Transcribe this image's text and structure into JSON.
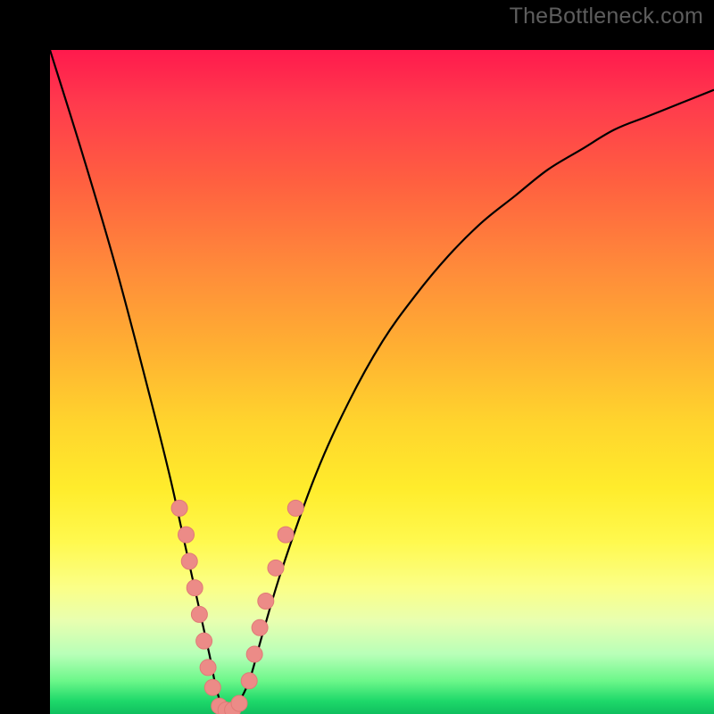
{
  "watermark": "TheBottleneck.com",
  "colors": {
    "frame": "#000000",
    "curve": "#000000",
    "marker_fill": "#ec8b87",
    "marker_stroke": "#e07a76",
    "gradient_top": "#ff1a4d",
    "gradient_bottom": "#0fbf5f"
  },
  "chart_data": {
    "type": "line",
    "title": "",
    "xlabel": "",
    "ylabel": "",
    "xlim": [
      0,
      100
    ],
    "ylim": [
      0,
      100
    ],
    "series": [
      {
        "name": "bottleneck-curve",
        "x": [
          0,
          5,
          10,
          15,
          18,
          20,
          22,
          24,
          25,
          26,
          27,
          28,
          30,
          32,
          35,
          40,
          45,
          50,
          55,
          60,
          65,
          70,
          75,
          80,
          85,
          90,
          95,
          100
        ],
        "y": [
          100,
          84,
          67,
          48,
          36,
          27,
          18,
          9,
          4,
          1,
          0,
          1,
          5,
          12,
          22,
          36,
          47,
          56,
          63,
          69,
          74,
          78,
          82,
          85,
          88,
          90,
          92,
          94
        ]
      }
    ],
    "markers": [
      {
        "name": "left-cluster",
        "points": [
          {
            "x": 19.5,
            "y": 31
          },
          {
            "x": 20.5,
            "y": 27
          },
          {
            "x": 21.0,
            "y": 23
          },
          {
            "x": 21.8,
            "y": 19
          },
          {
            "x": 22.5,
            "y": 15
          },
          {
            "x": 23.2,
            "y": 11
          },
          {
            "x": 23.8,
            "y": 7
          },
          {
            "x": 24.5,
            "y": 4
          }
        ]
      },
      {
        "name": "bottom-cluster",
        "points": [
          {
            "x": 25.5,
            "y": 1.2
          },
          {
            "x": 26.5,
            "y": 0.6
          },
          {
            "x": 27.5,
            "y": 0.6
          },
          {
            "x": 28.5,
            "y": 1.6
          }
        ]
      },
      {
        "name": "right-cluster",
        "points": [
          {
            "x": 30.0,
            "y": 5
          },
          {
            "x": 30.8,
            "y": 9
          },
          {
            "x": 31.6,
            "y": 13
          },
          {
            "x": 32.5,
            "y": 17
          },
          {
            "x": 34.0,
            "y": 22
          },
          {
            "x": 35.5,
            "y": 27
          },
          {
            "x": 37.0,
            "y": 31
          }
        ]
      }
    ]
  }
}
